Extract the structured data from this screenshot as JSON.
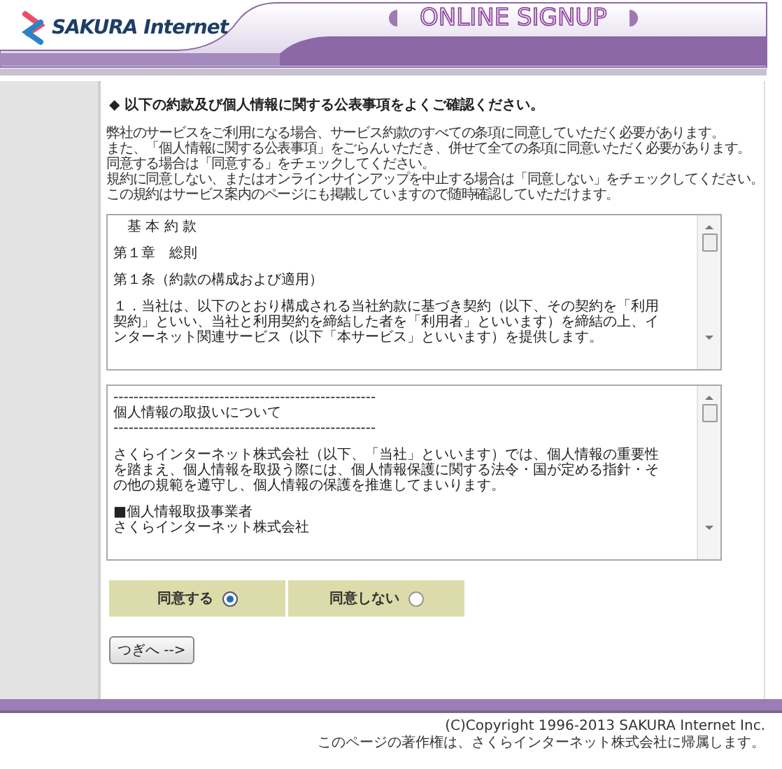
{
  "header": {
    "logo": "SAKURA Internet",
    "title": "ONLINE SIGNUP"
  },
  "notice": {
    "heading": "◆ 以下の約款及び個人情報に関する公表事項をよくご確認ください。",
    "lines": [
      "弊社のサービスをご利用になる場合、サービス約款のすべての条項に同意していただく必要があります。",
      "また、「個人情報に関する公表事項」をごらんいただき、併せて全ての条項に同意いただく必要があります。",
      "同意する場合は「同意する」をチェックしてください。",
      "規約に同意しない、またはオンラインサインアップを中止する場合は「同意しない」をチェックしてください。",
      "この規約はサービス案内のページにも掲載していますので随時確認していただけます。"
    ]
  },
  "documents": [
    {
      "paragraphs": [
        [
          "　基 本 約 款"
        ],
        [
          "第１章　総則"
        ],
        [
          "第１条（約款の構成および適用）"
        ],
        [
          "１．当社は、以下のとおり構成される当社約款に基づき契約（以下、その契約を「利用",
          "契約」といい、当社と利用契約を締結した者を「利用者」といいます）を締結の上、イ",
          "ンターネット関連サービス（以下「本サービス」といいます）を提供します。"
        ]
      ]
    },
    {
      "paragraphs": [
        [
          "----------------------------------------------------",
          "個人情報の取扱いについて",
          "----------------------------------------------------"
        ],
        [
          "さくらインターネット株式会社（以下、「当社」といいます）では、個人情報の重要性",
          "を踏まえ、個人情報を取扱う際には、個人情報保護に関する法令・国が定める指針・そ",
          "の他の規範を遵守し、個人情報の保護を推進してまいります。"
        ],
        [
          "■個人情報取扱事業者",
          "さくらインターネット株式会社"
        ]
      ]
    }
  ],
  "agreement": {
    "options": [
      {
        "label": "同意する",
        "selected": true
      },
      {
        "label": "同意しない",
        "selected": false
      }
    ]
  },
  "next_button": "つぎへ -->",
  "footer": {
    "copyright": "(C)Copyright 1996-2013 SAKURA Internet Inc.",
    "ownership": "このページの著作権は、さくらインターネット株式会社に帰属します。"
  }
}
